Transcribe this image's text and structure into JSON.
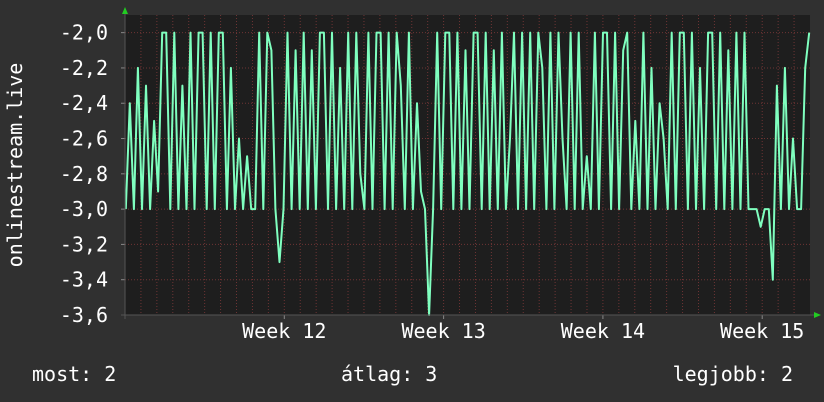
{
  "chart_data": {
    "type": "line",
    "ylabel": "onlinestream.live",
    "ylim": [
      -3.6,
      -1.9
    ],
    "xlim": [
      0,
      43
    ],
    "y_ticks": [
      -2.0,
      -2.2,
      -2.4,
      -2.6,
      -2.8,
      -3.0,
      -3.2,
      -3.4,
      -3.6
    ],
    "y_tick_labels": [
      "-2,0",
      "-2,2",
      "-2,4",
      "-2,6",
      "-2,8",
      "-3,0",
      "-3,2",
      "-3,4",
      "-3,6"
    ],
    "x_ticks": [
      {
        "label": "Week 12",
        "x": 10
      },
      {
        "label": "Week 13",
        "x": 20
      },
      {
        "label": "Week 14",
        "x": 30
      },
      {
        "label": "Week 15",
        "x": 40
      }
    ],
    "grid": true,
    "line_color": "#7fffbf",
    "series": [
      {
        "values": [
          -3.0,
          -2.4,
          -3.0,
          -2.2,
          -3.0,
          -2.3,
          -3.0,
          -2.5,
          -2.9,
          -2.0,
          -2.0,
          -3.0,
          -2.0,
          -3.0,
          -2.3,
          -3.0,
          -2.0,
          -3.0,
          -2.0,
          -2.0,
          -3.0,
          -2.0,
          -3.0,
          -2.0,
          -2.0,
          -3.0,
          -2.2,
          -3.0,
          -2.6,
          -3.0,
          -2.7,
          -3.0,
          -3.0,
          -2.0,
          -3.0,
          -2.0,
          -2.1,
          -3.0,
          -3.3,
          -3.0,
          -2.0,
          -3.0,
          -2.1,
          -3.0,
          -2.0,
          -3.0,
          -2.1,
          -3.0,
          -2.0,
          -2.0,
          -3.0,
          -2.0,
          -3.0,
          -2.2,
          -3.0,
          -2.0,
          -3.0,
          -2.0,
          -2.8,
          -3.0,
          -2.0,
          -3.0,
          -2.0,
          -2.0,
          -3.0,
          -2.0,
          -3.0,
          -2.0,
          -2.3,
          -3.0,
          -2.0,
          -3.0,
          -2.4,
          -2.9,
          -3.0,
          -3.6,
          -3.0,
          -2.0,
          -3.0,
          -2.0,
          -2.0,
          -3.0,
          -2.0,
          -3.0,
          -2.1,
          -3.0,
          -2.0,
          -2.0,
          -3.0,
          -2.0,
          -3.0,
          -2.1,
          -3.0,
          -2.0,
          -3.0,
          -2.6,
          -2.0,
          -3.0,
          -2.0,
          -3.0,
          -2.0,
          -3.0,
          -2.0,
          -2.2,
          -3.0,
          -2.0,
          -3.0,
          -2.0,
          -2.6,
          -3.0,
          -2.0,
          -3.0,
          -2.0,
          -3.0,
          -2.7,
          -3.0,
          -2.0,
          -3.0,
          -2.0,
          -2.0,
          -3.0,
          -2.0,
          -3.0,
          -2.1,
          -2.0,
          -3.0,
          -2.5,
          -3.0,
          -2.0,
          -3.0,
          -2.2,
          -3.0,
          -2.4,
          -2.6,
          -3.0,
          -2.0,
          -3.0,
          -2.0,
          -2.0,
          -3.0,
          -2.0,
          -3.0,
          -2.2,
          -3.0,
          -2.0,
          -2.0,
          -3.0,
          -2.0,
          -3.0,
          -2.1,
          -3.0,
          -2.0,
          -3.0,
          -2.0,
          -3.0,
          -3.0,
          -3.0,
          -3.1,
          -3.0,
          -3.0,
          -3.4,
          -2.3,
          -3.0,
          -2.2,
          -3.0,
          -2.6,
          -3.0,
          -3.0,
          -2.2,
          -2.0
        ]
      }
    ]
  },
  "stats": {
    "now": "most: 2",
    "average": "átlag: 3",
    "best": "legjobb: 2"
  }
}
